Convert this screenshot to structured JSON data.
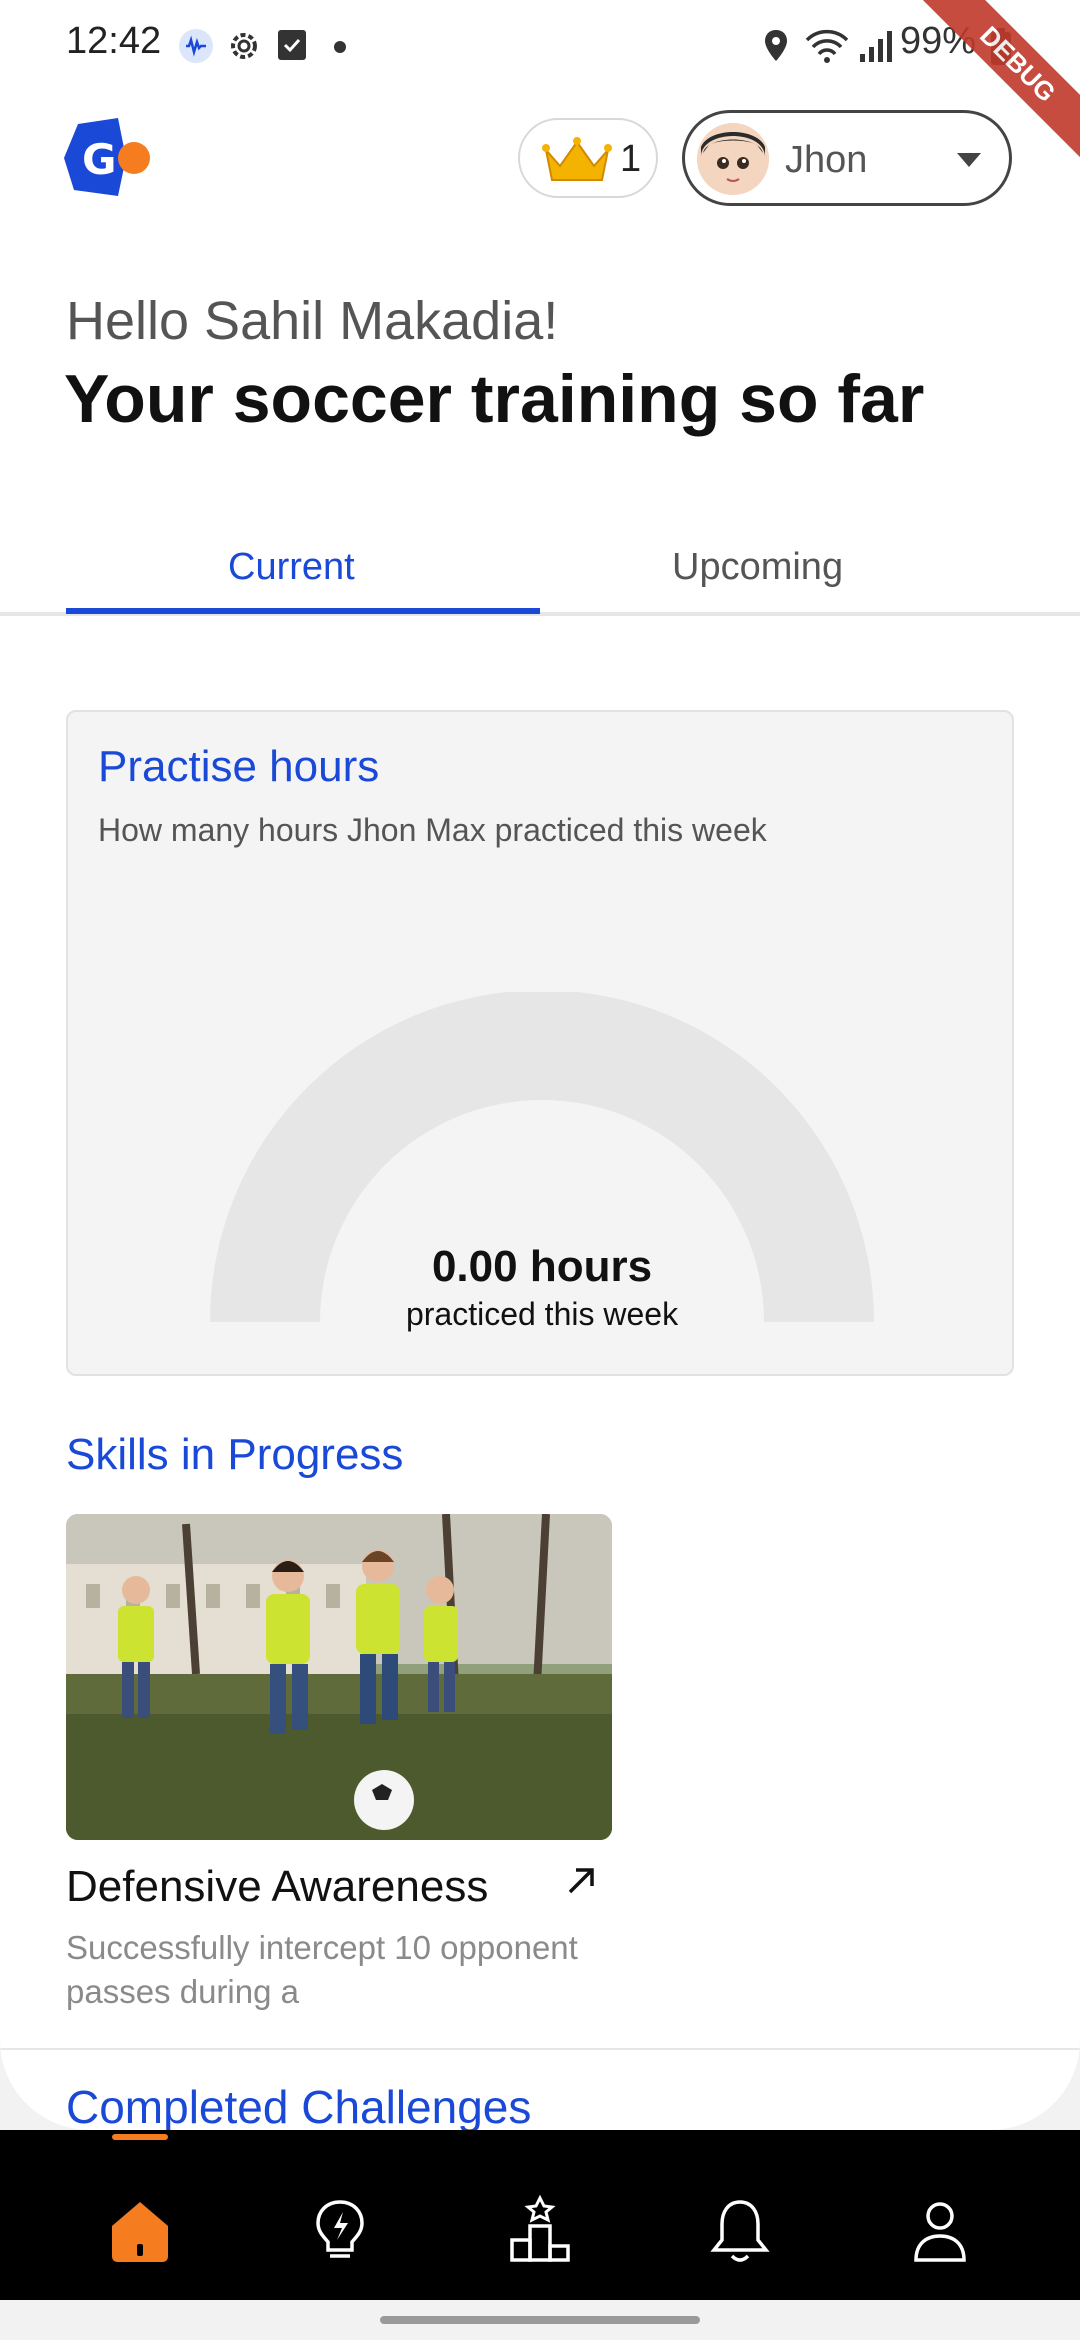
{
  "status_bar": {
    "time": "12:42",
    "battery": "99%"
  },
  "debug_banner": "DEBUG",
  "header": {
    "crown_count": "1",
    "profile_name": "Jhon"
  },
  "greeting": "Hello Sahil Makadia!",
  "headline": "Your soccer training so far",
  "tabs": [
    {
      "label": "Current",
      "active": true
    },
    {
      "label": "Upcoming",
      "active": false
    }
  ],
  "practise_card": {
    "title": "Practise hours",
    "subtitle": "How many hours Jhon Max practiced this week",
    "value": "0.00 hours",
    "value_label": "practiced this week",
    "progress": 0
  },
  "skills": {
    "title": "Skills in Progress",
    "items": [
      {
        "name": "Defensive Awareness",
        "description": "Successfully intercept 10 opponent passes during a"
      }
    ]
  },
  "completed_title": "Completed Challenges",
  "bottom_nav": [
    {
      "icon": "home-icon",
      "active": true
    },
    {
      "icon": "bulb-icon",
      "active": false
    },
    {
      "icon": "podium-icon",
      "active": false
    },
    {
      "icon": "bell-icon",
      "active": false
    },
    {
      "icon": "person-icon",
      "active": false
    }
  ],
  "colors": {
    "accent": "#1a49d8",
    "nav_active": "#f57c1f",
    "brand_orange": "#f57c1f"
  }
}
